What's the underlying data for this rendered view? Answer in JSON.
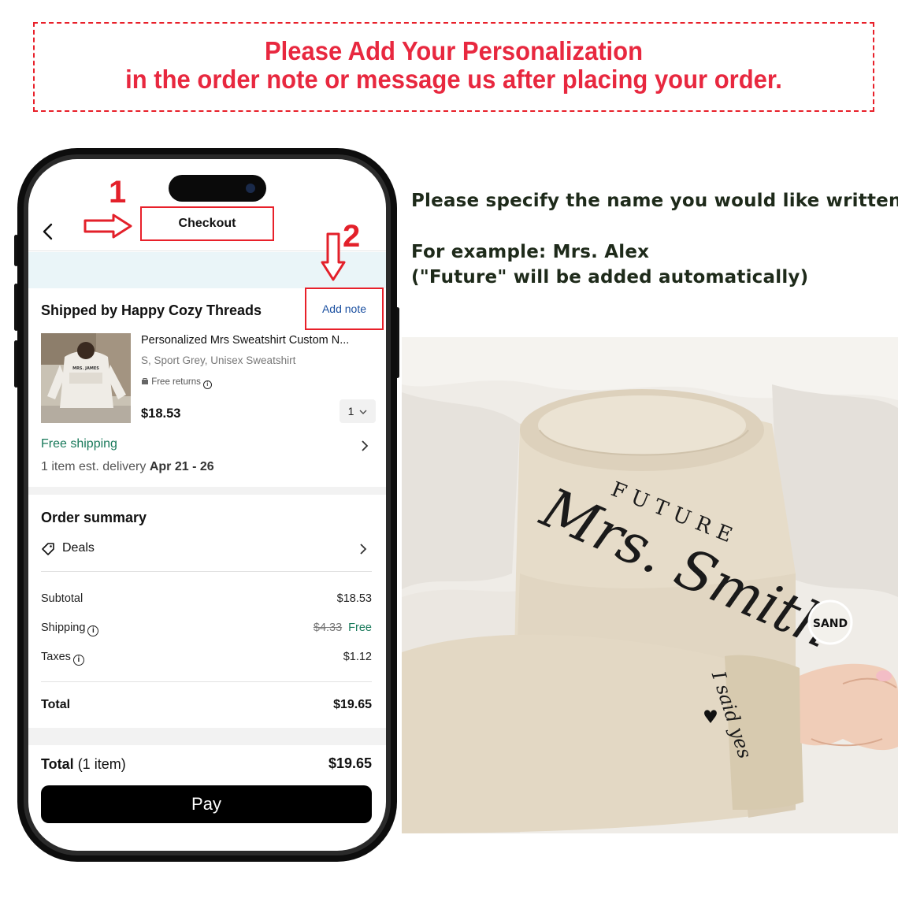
{
  "banner": {
    "line1": "Please Add Your Personalization",
    "line2": "in the order note or message us after placing your order."
  },
  "instructions": {
    "line1": "Please specify the name you would like written!",
    "line2": "For example: Mrs. Alex",
    "line3": "(\"Future\" will be added automatically)"
  },
  "annotations": {
    "step1": "1",
    "step2": "2"
  },
  "checkout": {
    "header_title": "Checkout",
    "shipped_by": "Shipped by Happy Cozy Threads",
    "add_note": "Add note",
    "product": {
      "title": "Personalized Mrs Sweatshirt Custom N...",
      "variant": "S, Sport Grey, Unisex Sweatshirt",
      "free_returns": "Free returns",
      "price": "$18.53",
      "quantity": "1",
      "thumb_text": "MRS. JAMES"
    },
    "free_shipping": "Free shipping",
    "delivery_prefix": "1 item est. delivery ",
    "delivery_dates": "Apr 21 - 26",
    "order_summary_title": "Order summary",
    "deals": "Deals",
    "subtotal_label": "Subtotal",
    "subtotal_value": "$18.53",
    "shipping_label": "Shipping",
    "shipping_old": "$4.33",
    "shipping_value": "Free",
    "taxes_label": "Taxes",
    "taxes_value": "$1.12",
    "total_label": "Total",
    "total_value": "$19.65",
    "grand_total_label": "Total",
    "grand_total_items": "(1 item)",
    "grand_total_value": "$19.65",
    "pay_button": "Pay"
  },
  "sweatshirt": {
    "word_future": "FUTURE",
    "word_name": "Mrs. Smith",
    "sleeve_text": "I said yes",
    "color_badge": "SAND"
  },
  "colors": {
    "accent_red": "#e8202a",
    "banner_text": "#e8283f",
    "link_blue": "#1a4fa0",
    "shipping_green": "#18795a",
    "instruction_text": "#1e2a1a"
  }
}
